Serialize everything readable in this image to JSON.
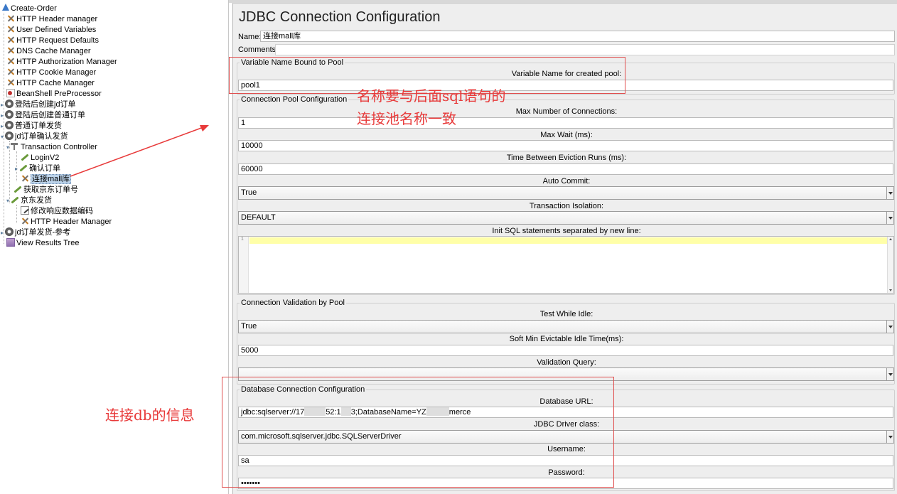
{
  "tree": {
    "items": [
      {
        "label": "Create-Order",
        "icon": "test-plan-icon"
      },
      {
        "label": "HTTP Header manager",
        "icon": "config-element-icon"
      },
      {
        "label": "User Defined Variables",
        "icon": "config-element-icon"
      },
      {
        "label": "HTTP Request Defaults",
        "icon": "config-element-icon"
      },
      {
        "label": "DNS Cache Manager",
        "icon": "config-element-icon"
      },
      {
        "label": "HTTP Authorization Manager",
        "icon": "config-element-icon"
      },
      {
        "label": "HTTP Cookie Manager",
        "icon": "config-element-icon"
      },
      {
        "label": "HTTP Cache Manager",
        "icon": "config-element-icon"
      },
      {
        "label": "BeanShell PreProcessor",
        "icon": "preprocessor-icon"
      },
      {
        "label": "登陆后创建jd订单",
        "icon": "thread-group-icon"
      },
      {
        "label": "登陆后创建普通订单",
        "icon": "thread-group-icon"
      },
      {
        "label": "普通订单发货",
        "icon": "thread-group-icon"
      },
      {
        "label": "jd订单确认发货",
        "icon": "thread-group-icon"
      },
      {
        "label": "Transaction Controller",
        "icon": "transaction-controller-icon"
      },
      {
        "label": "LoginV2",
        "icon": "sampler-icon"
      },
      {
        "label": "确认订单",
        "icon": "sampler-icon"
      },
      {
        "label": "连接mall库",
        "icon": "config-element-icon"
      },
      {
        "label": "获取京东订单号",
        "icon": "sampler-icon"
      },
      {
        "label": "京东发货",
        "icon": "sampler-icon"
      },
      {
        "label": "修改响应数据编码",
        "icon": "postprocessor-icon"
      },
      {
        "label": "HTTP Header Manager",
        "icon": "config-element-icon"
      },
      {
        "label": "jd订单发货-参考",
        "icon": "thread-group-icon"
      },
      {
        "label": "View Results Tree",
        "icon": "listener-icon"
      }
    ]
  },
  "config": {
    "title": "JDBC Connection Configuration",
    "name_label": "Name:",
    "name_value": "连接mall库",
    "comments_label": "Comments:",
    "comments_value": "",
    "var_group": {
      "title": "Variable Name Bound to Pool",
      "var_label": "Variable Name for created pool:",
      "var_value": "pool1"
    },
    "pool_group": {
      "title": "Connection Pool Configuration",
      "max_conn_label": "Max Number of Connections:",
      "max_conn_value": "1",
      "max_wait_label": "Max Wait (ms):",
      "max_wait_value": "10000",
      "eviction_label": "Time Between Eviction Runs (ms):",
      "eviction_value": "60000",
      "auto_commit_label": "Auto Commit:",
      "auto_commit_value": "True",
      "isolation_label": "Transaction Isolation:",
      "isolation_value": "DEFAULT",
      "init_sql_label": "Init SQL statements separated by new line:",
      "init_sql_line": "1"
    },
    "validation_group": {
      "title": "Connection Validation by Pool",
      "test_idle_label": "Test While Idle:",
      "test_idle_value": "True",
      "soft_min_label": "Soft Min Evictable Idle Time(ms):",
      "soft_min_value": "5000",
      "query_label": "Validation Query:",
      "query_value": ""
    },
    "db_group": {
      "title": "Database Connection Configuration",
      "url_label": "Database URL:",
      "url_part1": "jdbc:sqlserver://17",
      "url_part2": "52:1",
      "url_part3": "3;DatabaseName=YZ",
      "url_part4": "merce",
      "driver_label": "JDBC Driver class:",
      "driver_value": "com.microsoft.sqlserver.jdbc.SQLServerDriver",
      "username_label": "Username:",
      "username_value": "sa",
      "password_label": "Password:",
      "password_value": "•••••••"
    }
  },
  "annotations": {
    "pool_note_line1": "名称要与后面sql语句的",
    "pool_note_line2": "连接池名称一致",
    "db_note": "连接db的信息",
    "color": "#e83a3a"
  }
}
